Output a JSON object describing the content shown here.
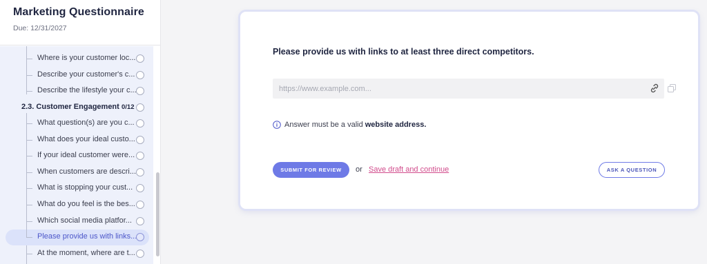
{
  "sidebar": {
    "title": "Marketing Questionnaire",
    "due": "Due: 12/31/2027",
    "items_before": [
      {
        "label": "Where is your customer loc..."
      },
      {
        "label": "Describe your customer's c..."
      },
      {
        "label": "Describe the lifestyle your c..."
      }
    ],
    "section": {
      "label": "2.3. Customer Engagement",
      "count": "0/12"
    },
    "items_after": [
      {
        "label": "What question(s) are you c..."
      },
      {
        "label": "What does your ideal custo..."
      },
      {
        "label": "If your ideal customer were..."
      },
      {
        "label": "When customers are descri..."
      },
      {
        "label": "What is stopping your cust..."
      },
      {
        "label": "What do you feel is the bes..."
      },
      {
        "label": "Which social media platfor..."
      },
      {
        "label": "Please provide us with links..."
      },
      {
        "label": "At the moment, where are t..."
      }
    ],
    "active_index": 7
  },
  "main": {
    "question": "Please provide us with links to at least three direct competitors.",
    "url_placeholder": "https://www.example.com...",
    "info_text": "Answer must be a valid",
    "info_bold": "website address.",
    "submit_label": "SUBMIT FOR REVIEW",
    "or_text": "or",
    "draft_label": "Save draft and continue",
    "ask_label": "ASK A QUESTION"
  },
  "colors": {
    "accent": "#6e7ae6",
    "link": "#d14a8b",
    "active_bg": "#dbe2fa"
  },
  "icons": [
    "link-icon",
    "copy-icon",
    "info-icon",
    "circle-status-icon"
  ]
}
